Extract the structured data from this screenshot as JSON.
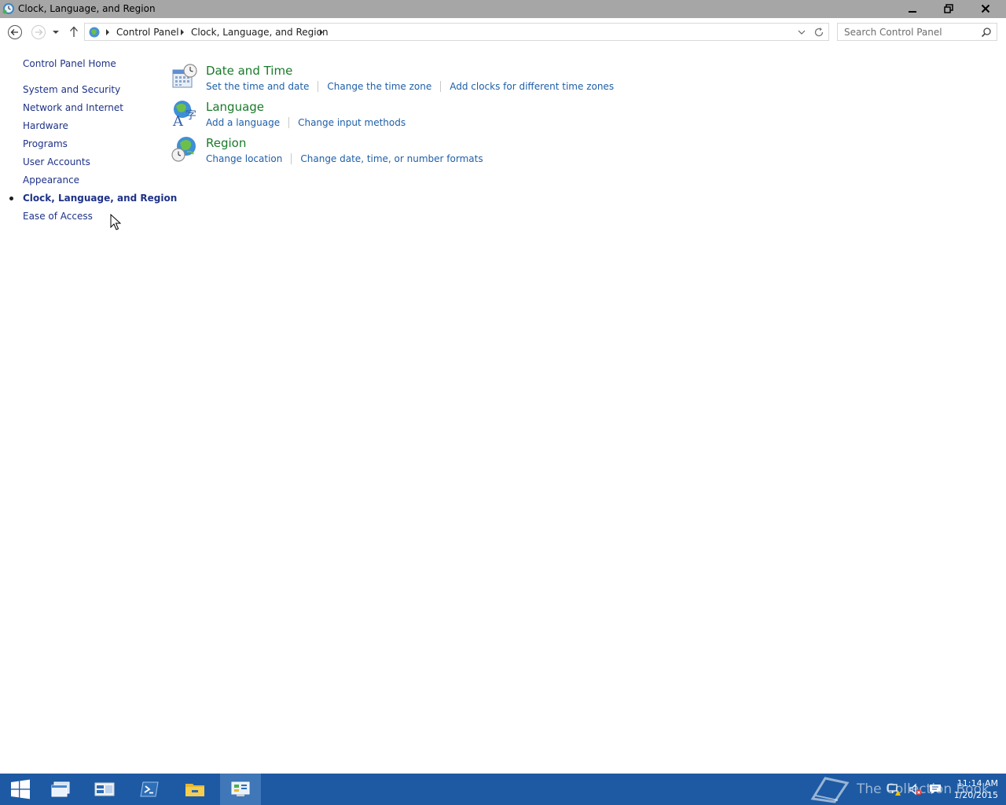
{
  "window": {
    "title": "Clock, Language, and Region"
  },
  "address_bar": {
    "crumbs": [
      "Control Panel",
      "Clock, Language, and Region"
    ]
  },
  "search": {
    "placeholder": "Search Control Panel"
  },
  "sidebar": {
    "home": "Control Panel Home",
    "items": [
      {
        "label": "System and Security",
        "active": false
      },
      {
        "label": "Network and Internet",
        "active": false
      },
      {
        "label": "Hardware",
        "active": false
      },
      {
        "label": "Programs",
        "active": false
      },
      {
        "label": "User Accounts",
        "active": false
      },
      {
        "label": "Appearance",
        "active": false
      },
      {
        "label": "Clock, Language, and Region",
        "active": true
      },
      {
        "label": "Ease of Access",
        "active": false
      }
    ]
  },
  "categories": [
    {
      "title": "Date and Time",
      "icon": "calendar-clock-icon",
      "links": [
        "Set the time and date",
        "Change the time zone",
        "Add clocks for different time zones"
      ]
    },
    {
      "title": "Language",
      "icon": "language-globe-icon",
      "links": [
        "Add a language",
        "Change input methods"
      ]
    },
    {
      "title": "Region",
      "icon": "region-globe-icon",
      "links": [
        "Change location",
        "Change date, time, or number formats"
      ]
    }
  ],
  "taskbar": {
    "apps": [
      "start-icon",
      "task-view-icon",
      "server-manager-icon",
      "powershell-icon",
      "file-explorer-icon",
      "control-panel-icon"
    ],
    "watermark": "The Collection Book",
    "time": "11:14 AM",
    "date": "1/20/2015"
  },
  "colors": {
    "link": "#1e5fa8",
    "category_title": "#1a7a2a",
    "sidebar_link": "#1e3287",
    "taskbar": "#1d5aa3",
    "titlebar": "#a6a6a6"
  }
}
